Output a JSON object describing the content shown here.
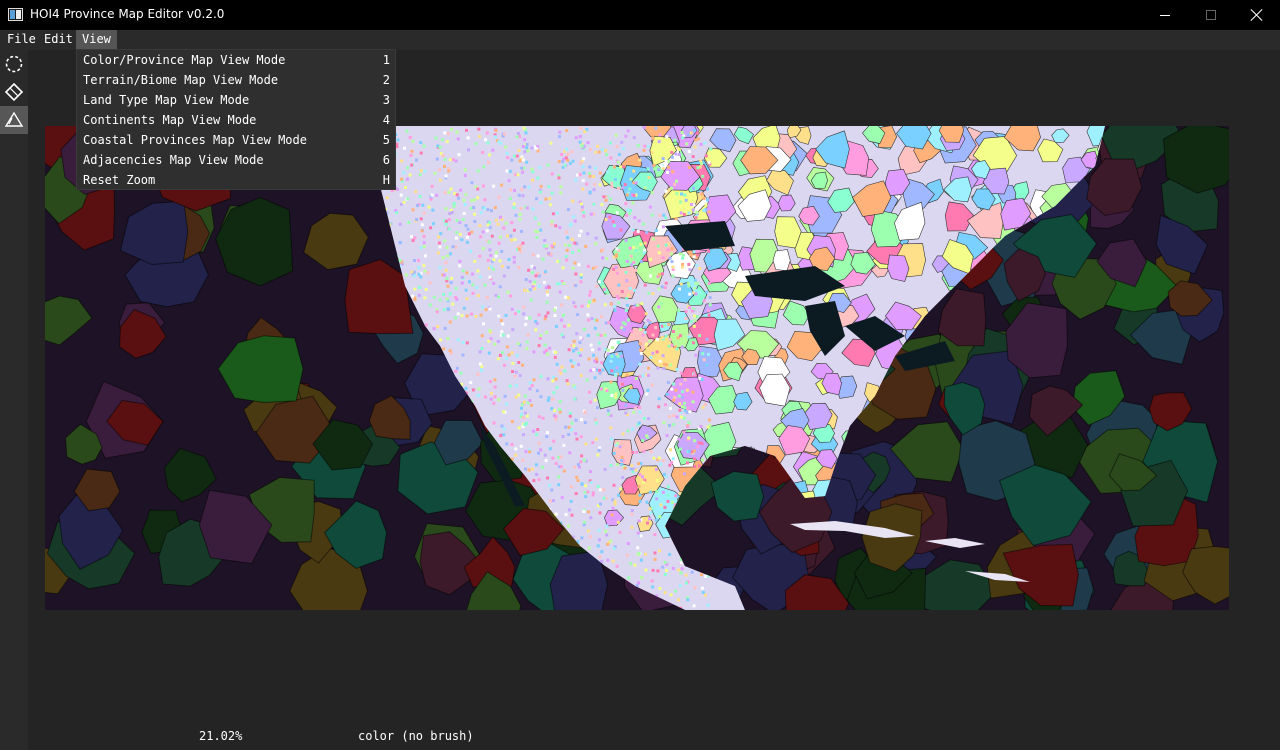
{
  "window": {
    "title": "HOI4 Province Map Editor v0.2.0",
    "icon": "app-icon"
  },
  "menubar": {
    "items": [
      "File",
      "Edit",
      "View"
    ],
    "open_menu": "View"
  },
  "view_menu": {
    "items": [
      {
        "label": "Color/Province Map View Mode",
        "shortcut": "1"
      },
      {
        "label": "Terrain/Biome Map View Mode",
        "shortcut": "2"
      },
      {
        "label": "Land Type Map View Mode",
        "shortcut": "3"
      },
      {
        "label": "Continents Map View Mode",
        "shortcut": "4"
      },
      {
        "label": "Coastal Provinces Map View Mode",
        "shortcut": "5"
      },
      {
        "label": "Adjacencies Map View Mode",
        "shortcut": "6"
      },
      {
        "label": "Reset Zoom",
        "shortcut": "H"
      }
    ]
  },
  "toolbar": {
    "tools": [
      "lasso-select-icon",
      "diamond-brush-icon",
      "triangle-tool-icon"
    ],
    "active_tool": "triangle-tool-icon"
  },
  "status": {
    "zoom": "21.02%",
    "brush": "color (no brush)"
  },
  "colors": {
    "background": "#2a2a2a",
    "titlebar": "#000000",
    "menu_highlight": "#555555",
    "dropdown": "#2f2f2f",
    "ocean_palette": [
      "#2b4a1c",
      "#3a1d3d",
      "#1f3a4a",
      "#4a2a14",
      "#173a28",
      "#3d1a2a",
      "#22224a",
      "#0f4a3a",
      "#4a3a12",
      "#102a12",
      "#5a1010",
      "#1a5a1a"
    ]
  }
}
